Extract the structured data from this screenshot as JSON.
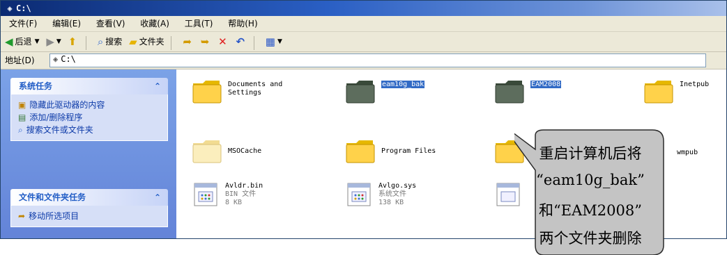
{
  "window": {
    "title": "C:\\"
  },
  "menu": [
    "文件(F)",
    "编辑(E)",
    "查看(V)",
    "收藏(A)",
    "工具(T)",
    "帮助(H)"
  ],
  "toolbar": {
    "back": "后退",
    "search": "搜索",
    "folders": "文件夹"
  },
  "address": {
    "label": "地址(D)",
    "value": "C:\\"
  },
  "tasks_panel": {
    "title": "系统任务",
    "items": [
      "隐藏此驱动器的内容",
      "添加/删除程序",
      "搜索文件或文件夹"
    ]
  },
  "file_tasks_panel": {
    "title": "文件和文件夹任务",
    "items": [
      "移动所选项目"
    ]
  },
  "files": [
    {
      "line1": "Documents and",
      "line2": "Settings",
      "type": "folder"
    },
    {
      "line1": "eam10g_bak",
      "type": "folder-dark",
      "selected": true
    },
    {
      "line1": "EAM2008",
      "type": "folder-dark",
      "selected": true
    },
    {
      "line1": "Inetpub",
      "type": "folder"
    },
    {
      "line1": "MSOCache",
      "type": "folder-light"
    },
    {
      "line1": "Program Files",
      "type": "folder"
    },
    {
      "line1": "wmpub",
      "type": "folder"
    },
    {
      "line1": "Avldr.bin",
      "line2": "BIN 文件",
      "line3": "8 KB",
      "type": "file"
    },
    {
      "line1": "Avlgo.sys",
      "line2": "系统文件",
      "line3": "138 KB",
      "type": "file"
    }
  ],
  "callout": {
    "lines": [
      "重启计算机后将",
      "“eam10g_bak”",
      "和“EAM2008”",
      "两个文件夹删除"
    ]
  },
  "colors": {
    "titlebar": "#0b2a72",
    "taskpane": "#6d8fdf",
    "selection": "#316ac5",
    "callout": "#c0c0c0"
  }
}
